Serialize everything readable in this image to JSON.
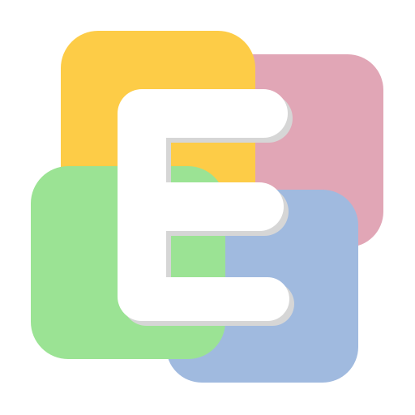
{
  "app_icon": {
    "icon_name": "letter-e-app-icon",
    "letter_glyph": "E",
    "colors": {
      "background": "#ffffff",
      "tile_yellow": "#fdcc47",
      "tile_pink": "#e1a6b6",
      "tile_green": "#9be394",
      "tile_blue": "#a0badf",
      "letter_fill": "#ffffff",
      "letter_shadow": "#d6d6d6"
    }
  }
}
